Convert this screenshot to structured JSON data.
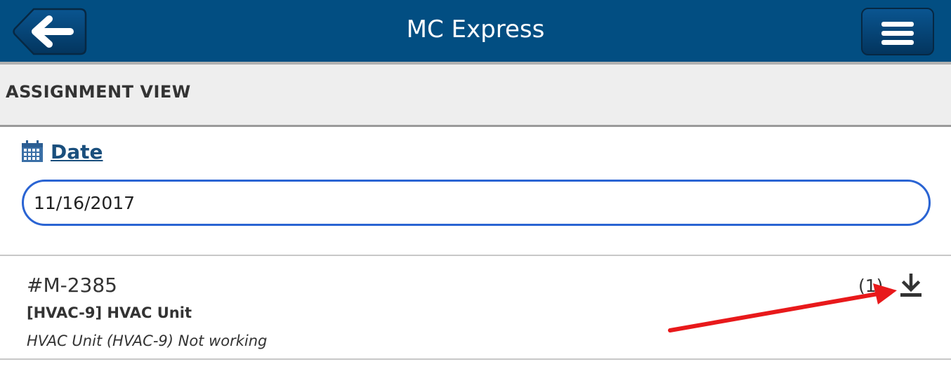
{
  "header": {
    "title": "MC Express",
    "back_icon": "arrow-left-icon",
    "menu_icon": "hamburger-menu-icon",
    "background_color": "#024e82"
  },
  "section": {
    "title": "ASSIGNMENT VIEW"
  },
  "date_filter": {
    "icon": "calendar-icon",
    "label": "Date",
    "value": "11/16/2017"
  },
  "work_orders": [
    {
      "number": "#M-2385",
      "asset": "[HVAC-9] HVAC Unit",
      "description": "HVAC Unit (HVAC-9) Not working",
      "count": "(1)",
      "download_icon": "download-icon"
    }
  ],
  "annotation": {
    "arrow_color": "#e8191b"
  }
}
